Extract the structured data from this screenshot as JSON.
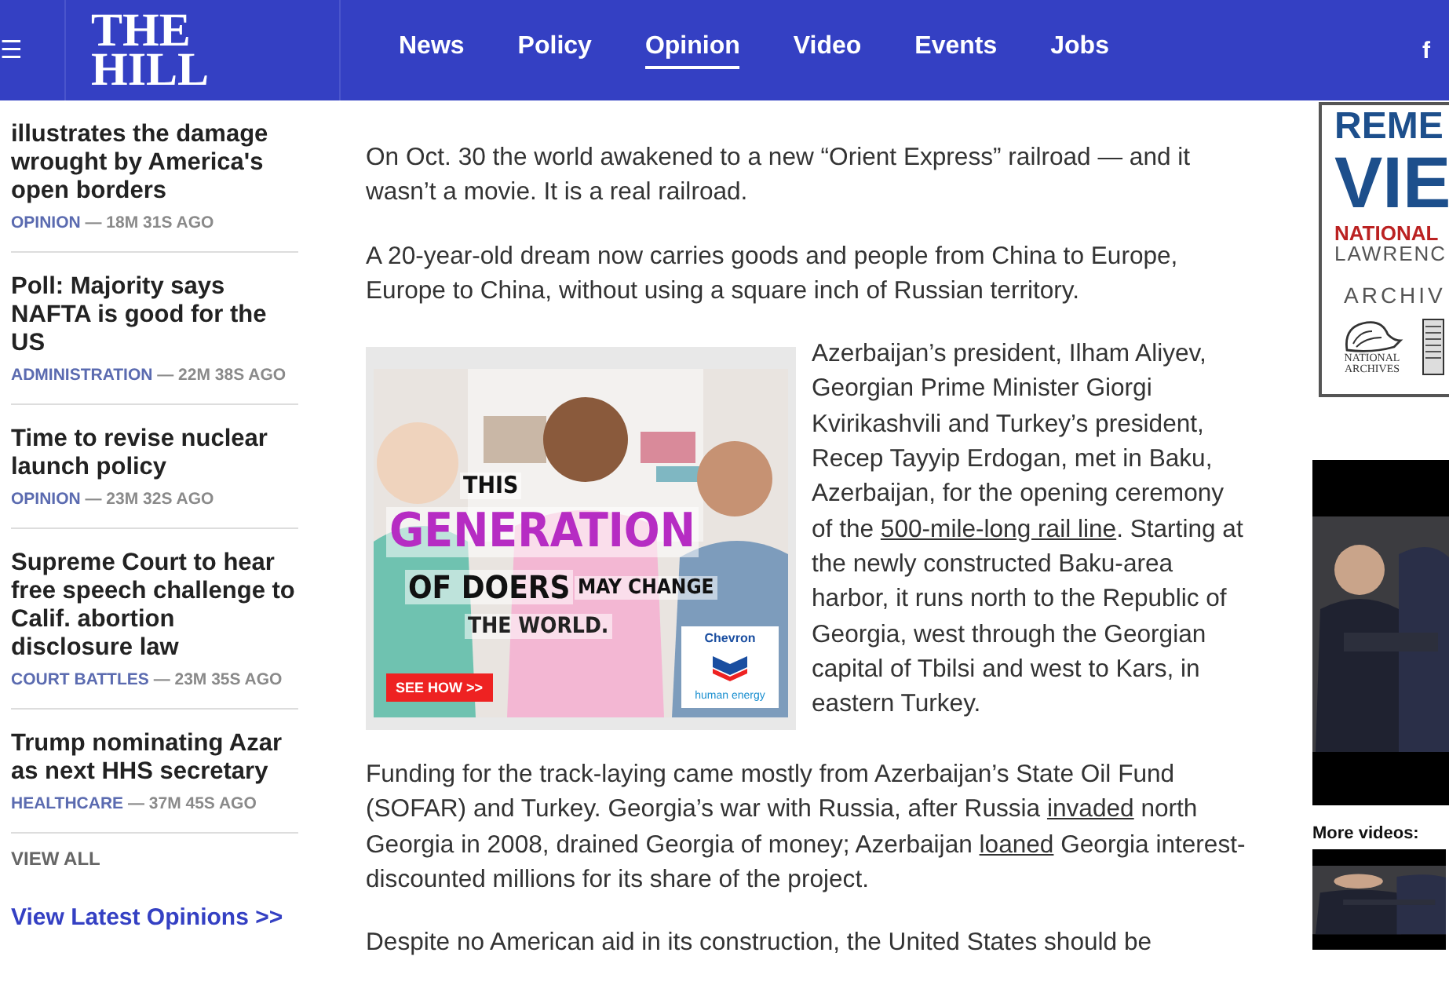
{
  "header": {
    "menu_icon": "☰",
    "logo": [
      "THE",
      "HILL"
    ],
    "nav": [
      {
        "label": "News",
        "selected": false
      },
      {
        "label": "Policy",
        "selected": false
      },
      {
        "label": "Opinion",
        "selected": true
      },
      {
        "label": "Video",
        "selected": false
      },
      {
        "label": "Events",
        "selected": false
      },
      {
        "label": "Jobs",
        "selected": false
      }
    ],
    "social_icon": "f"
  },
  "sidebar": {
    "items": [
      {
        "title": "illustrates the damage wrought by America's open borders",
        "category": "OPINION",
        "time": "— 18M 31S AGO"
      },
      {
        "title": "Poll: Majority says NAFTA is good for the US",
        "category": "ADMINISTRATION",
        "time": "— 22M 38S AGO"
      },
      {
        "title": "Time to revise nuclear launch policy",
        "category": "OPINION",
        "time": "— 23M 32S AGO"
      },
      {
        "title": "Supreme Court to hear free speech challenge to Calif. abortion disclosure law",
        "category": "COURT BATTLES",
        "time": "— 23M 35S AGO"
      },
      {
        "title": "Trump nominating Azar as next HHS secretary",
        "category": "HEALTHCARE",
        "time": "— 37M 45S AGO"
      }
    ],
    "view_all": "VIEW ALL",
    "latest_link": "View Latest Opinions >>"
  },
  "article": {
    "paragraphs": [
      {
        "parts": [
          {
            "kind": "text",
            "text": "On Oct. 30 the world awakened to a new “Orient Express” railroad — and it wasn’t a movie. It is a real railroad."
          }
        ]
      },
      {
        "parts": [
          {
            "kind": "text",
            "text": "A 20-year-old dream now carries goods and people from China to Europe, Europe to China, without using a square inch of Russian territory."
          }
        ]
      },
      {
        "kind": "with_ad",
        "parts": [
          {
            "kind": "text",
            "text": "Azerbaijan’s president, Ilham Aliyev, Georgian Prime Minister Giorgi Kvirikashvili and Turkey’s president, Recep Tayyip Erdogan, met in Baku, Azerbaijan, for the opening ceremony of the "
          },
          {
            "kind": "link",
            "text": "500-mile-long rail line"
          },
          {
            "kind": "text",
            "text": ". Starting at the newly constructed Baku-area harbor, it runs north to the Republic of Georgia, west through the Georgian capital of Tbilsi and west to Kars, in eastern Turkey."
          }
        ]
      },
      {
        "parts": [
          {
            "kind": "text",
            "text": "Funding for the track-laying came mostly from Azerbaijan’s State Oil Fund (SOFAR) and Turkey. Georgia’s war with Russia, after Russia "
          },
          {
            "kind": "link",
            "text": "invaded"
          },
          {
            "kind": "text",
            "text": " north Georgia in 2008, drained Georgia of money; Azerbaijan "
          },
          {
            "kind": "link",
            "text": "loaned"
          },
          {
            "kind": "text",
            "text": " Georgia interest-discounted millions for its share of the project."
          }
        ]
      },
      {
        "parts": [
          {
            "kind": "text",
            "text": "Despite no American aid in its construction, the United States should be"
          }
        ]
      }
    ],
    "ad": {
      "kind": "picture",
      "lines": [
        "THIS",
        "GENERATION",
        "OF DOERS",
        "MAY CHANGE",
        "THE WORLD."
      ],
      "button": "SEE HOW >>",
      "brand": "Chevron",
      "tagline": "human energy"
    }
  },
  "rail": {
    "banner": [
      "REME",
      "VIE",
      "NATIONAL",
      "LAWRENC",
      "ARCHIV"
    ],
    "archives_logo": "NATIONAL ARCHIVES",
    "video": {
      "kind": "picture"
    },
    "more_videos": "More videos:"
  }
}
